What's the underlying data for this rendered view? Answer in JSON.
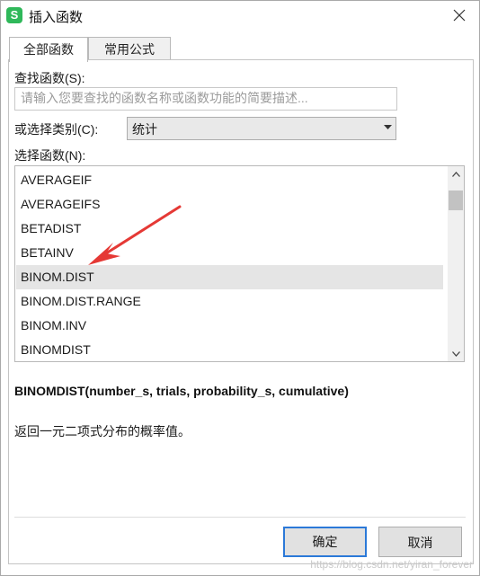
{
  "window": {
    "title": "插入函数",
    "app_icon_glyph": "S",
    "close_glyph": "✕"
  },
  "tabs": [
    {
      "label": "全部函数",
      "active": true
    },
    {
      "label": "常用公式",
      "active": false
    }
  ],
  "search": {
    "label": "查找函数(S):",
    "placeholder": "请输入您要查找的函数名称或函数功能的简要描述...",
    "value": ""
  },
  "category": {
    "label": "或选择类别(C):",
    "selected": "统计"
  },
  "function_list": {
    "label": "选择函数(N):",
    "items": [
      "AVERAGEIF",
      "AVERAGEIFS",
      "BETADIST",
      "BETAINV",
      "BINOM.DIST",
      "BINOM.DIST.RANGE",
      "BINOM.INV",
      "BINOMDIST"
    ],
    "selected": "BINOM.DIST"
  },
  "details": {
    "signature": "BINOMDIST(number_s, trials, probability_s, cumulative)",
    "description": "返回一元二项式分布的概率值。"
  },
  "buttons": {
    "ok": "确定",
    "cancel": "取消"
  },
  "watermark": "https://blog.csdn.net/yiran_forever",
  "colors": {
    "accent": "#2b79d8",
    "annotation_arrow": "#e53935",
    "app_icon": "#2fb85a"
  }
}
